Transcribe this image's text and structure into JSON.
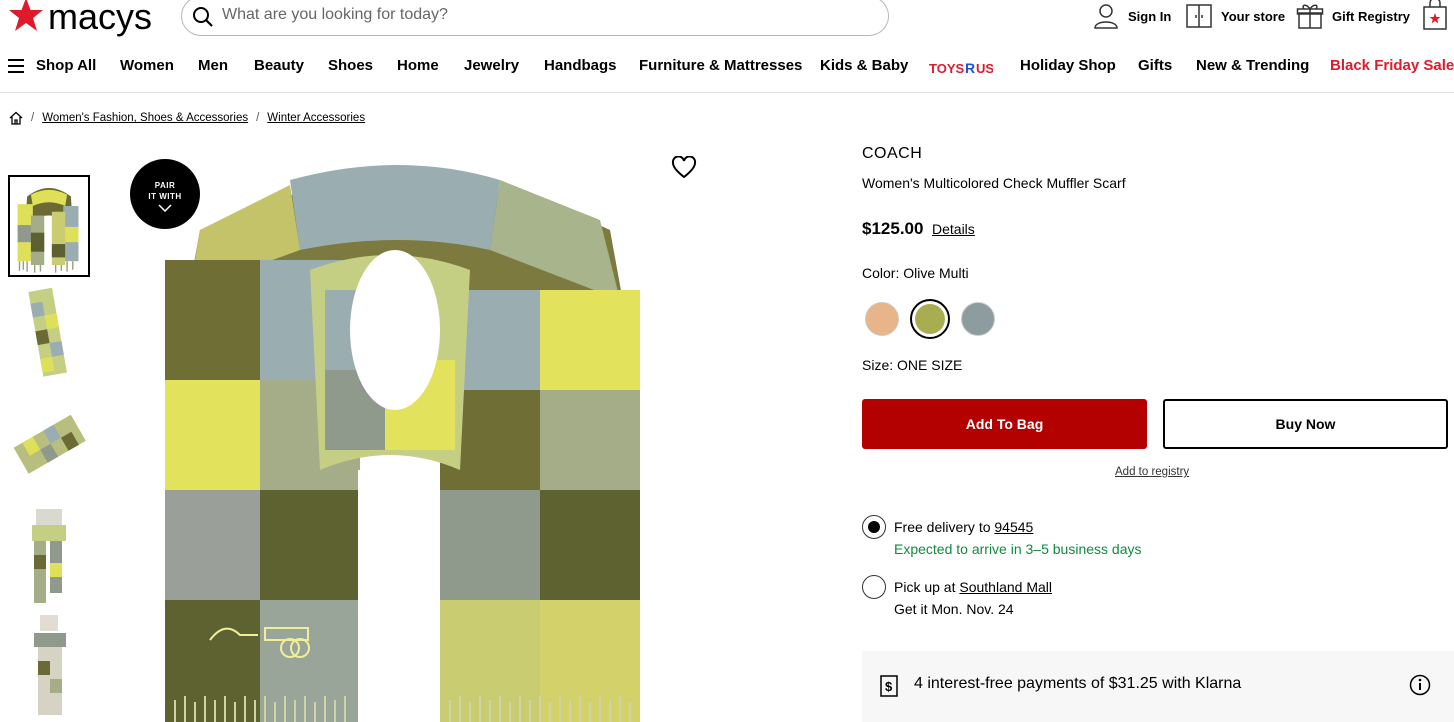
{
  "brand": {
    "name": "macy's",
    "accent": "#e01a2b"
  },
  "search": {
    "placeholder": "What are you looking for today?"
  },
  "utility": {
    "sign_in": "Sign In",
    "store": "Your store",
    "registry": "Gift Registry"
  },
  "nav": {
    "items": [
      "Shop All",
      "Women",
      "Men",
      "Beauty",
      "Shoes",
      "Home",
      "Jewelry",
      "Handbags",
      "Furniture & Mattresses",
      "Kids & Baby",
      "Toys\"R\"Us",
      "Holiday Shop",
      "Gifts",
      "New & Trending",
      "Black Friday Sale"
    ]
  },
  "breadcrumb": [
    "Women's Fashion, Shoes & Accessories",
    "Winter Accessories"
  ],
  "gallery": {
    "pair_label_1": "PAIR",
    "pair_label_2": "IT WITH"
  },
  "product": {
    "brand": "COACH",
    "name": "Women's Multicolored Check Muffler Scarf",
    "price": "$125.00",
    "details_link": "Details",
    "color_label": "Color: Olive Multi",
    "swatches": [
      "#e8b48a",
      "#a9ad52",
      "#8c9c9f"
    ],
    "size_label": "Size: ONE SIZE",
    "add_to_bag": "Add To Bag",
    "buy_now": "Buy Now",
    "add_to_registry": "Add to registry",
    "button_color": "#b30000"
  },
  "fulfillment": {
    "delivery_prefix": "Free delivery",
    "delivery_to": "to",
    "zip": "94545",
    "delivery_eta": "Expected to arrive in 3–5 business days",
    "pickup_prefix": "Pick up at",
    "store": "Southland Mall",
    "pickup_eta": "Get it Mon. Nov. 24"
  },
  "klarna": {
    "text": "4 interest-free payments of $31.25 with Klarna"
  }
}
